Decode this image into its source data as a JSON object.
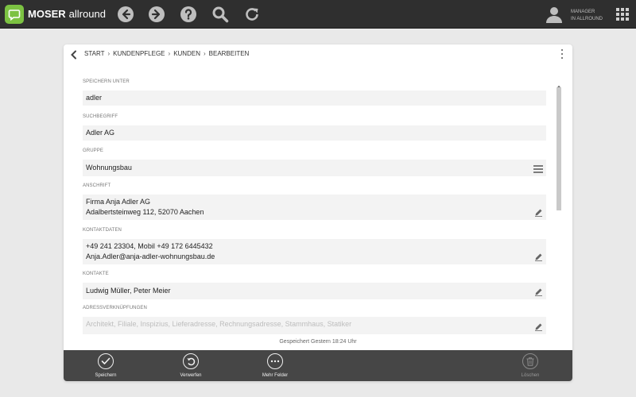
{
  "app": {
    "brand": "MOSER",
    "product": "allround"
  },
  "user": {
    "line1": "MANAGER",
    "line2": "IN ALLROUND"
  },
  "breadcrumb": [
    "START",
    "KUNDENPFLEGE",
    "KUNDEN",
    "BEARBEITEN"
  ],
  "fields": {
    "speichern_unter": {
      "label": "SPEICHERN UNTER",
      "value": "adler"
    },
    "suchbegriff": {
      "label": "SUCHBEGRIFF",
      "value": "Adler AG"
    },
    "gruppe": {
      "label": "GRUPPE",
      "value": "Wohnungsbau"
    },
    "anschrift": {
      "label": "ANSCHRIFT",
      "line1": "Firma Anja Adler AG",
      "line2": "Adalbertsteinweg 112, 52070 Aachen"
    },
    "kontaktdaten": {
      "label": "KONTAKTDATEN",
      "line1": "+49 241 23304, Mobil +49 172 6445432",
      "line2": "Anja.Adler@anja-adler-wohnungsbau.de"
    },
    "kontakte": {
      "label": "KONTAKTE",
      "value": "Ludwig Müller, Peter Meier"
    },
    "adressverknuepfungen": {
      "label": "ADRESSVERKNÜPFUNGEN",
      "value": "Architekt, Filiale, Inspizius, Lieferadresse, Rechnungsadresse, Stammhaus, Statiker"
    }
  },
  "status": "Gespeichert Gestern 18:24 Uhr",
  "actions": {
    "save": "Speichern",
    "discard": "Verwerfen",
    "more": "Mehr Felder",
    "delete": "Löschen"
  },
  "colors": {
    "accent": "#7cc242",
    "topbar": "#2f2f2f",
    "actionbar": "#464646"
  }
}
